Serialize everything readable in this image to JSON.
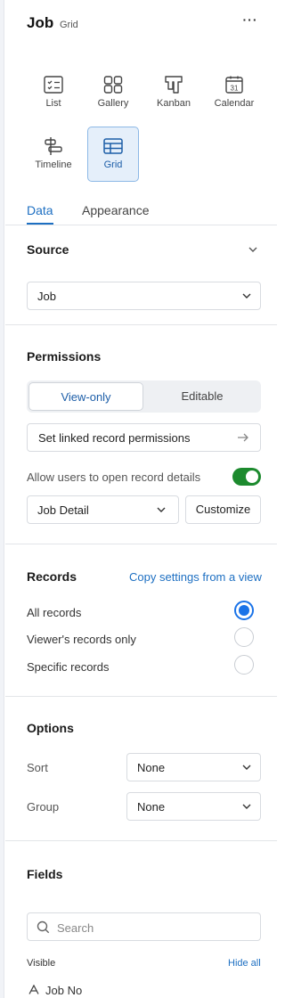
{
  "header": {
    "title": "Job",
    "subtitle": "Grid",
    "more_label": "···"
  },
  "views": [
    {
      "label": "List",
      "icon": "list-checklist-icon",
      "selected": false
    },
    {
      "label": "Gallery",
      "icon": "gallery-grid-icon",
      "selected": false
    },
    {
      "label": "Kanban",
      "icon": "kanban-icon",
      "selected": false
    },
    {
      "label": "Calendar",
      "icon": "calendar-icon",
      "selected": false
    },
    {
      "label": "Timeline",
      "icon": "timeline-icon",
      "selected": false
    },
    {
      "label": "Grid",
      "icon": "grid-table-icon",
      "selected": true
    }
  ],
  "tabs": {
    "data": "Data",
    "appearance": "Appearance",
    "active": "Data"
  },
  "source": {
    "title": "Source",
    "value": "Job"
  },
  "permissions": {
    "title": "Permissions",
    "view_only": "View-only",
    "editable": "Editable",
    "selected": "View-only",
    "linked_label": "Set linked record permissions",
    "allow_details_label": "Allow users to open record details",
    "allow_details_on": true,
    "detail_select": "Job Detail",
    "customize_label": "Customize"
  },
  "records": {
    "title": "Records",
    "copy_link": "Copy settings from a view",
    "options": [
      {
        "label": "All records",
        "checked": true
      },
      {
        "label": "Viewer's records only",
        "checked": false
      },
      {
        "label": "Specific records",
        "checked": false
      }
    ]
  },
  "options": {
    "title": "Options",
    "sort_label": "Sort",
    "sort_value": "None",
    "group_label": "Group",
    "group_value": "None"
  },
  "fields": {
    "title": "Fields",
    "search_placeholder": "Search",
    "visible_label": "Visible",
    "hide_all_label": "Hide all",
    "items": [
      {
        "name": "Job No",
        "icon": "text-field-icon"
      }
    ]
  },
  "colors": {
    "accent": "#1d6fc2",
    "toggle_on": "#1c8a2e",
    "radio_checked": "#1a73e8",
    "selected_tile_bg": "#e5effa"
  }
}
